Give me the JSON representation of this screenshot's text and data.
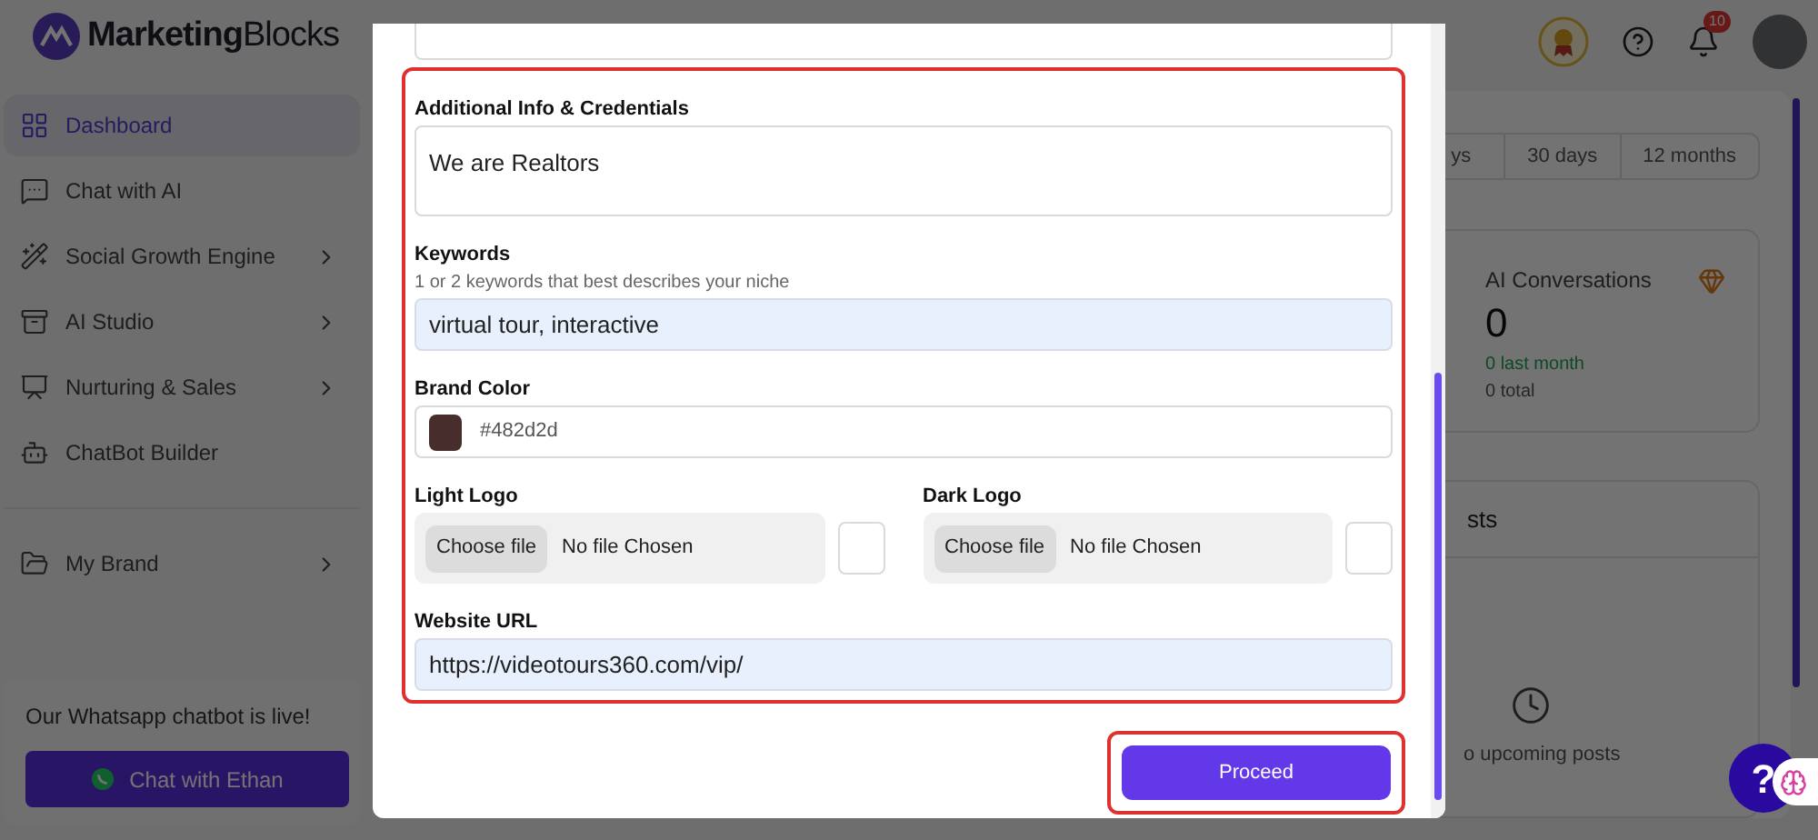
{
  "header": {
    "brand": "**Marketing**Blocks",
    "notification_count": "10"
  },
  "sidebar": {
    "items": [
      {
        "label": "Dashboard",
        "selected": true,
        "has_submenu": false
      },
      {
        "label": "Chat with AI",
        "selected": false,
        "has_submenu": false
      },
      {
        "label": "Social Growth Engine",
        "selected": false,
        "has_submenu": true
      },
      {
        "label": "AI Studio",
        "selected": false,
        "has_submenu": true
      },
      {
        "label": "Nurturing & Sales",
        "selected": false,
        "has_submenu": true
      },
      {
        "label": "ChatBot Builder",
        "selected": false,
        "has_submenu": false
      },
      {
        "label": "My Brand",
        "selected": false,
        "has_submenu": true
      }
    ],
    "promo": {
      "text": "Our Whatsapp chatbot is live!",
      "button": "Chat with Ethan"
    }
  },
  "dashboard": {
    "range_tabs": [
      {
        "label": "ys",
        "selected": false
      },
      {
        "label": "30 days",
        "selected": false
      },
      {
        "label": "12 months",
        "selected": false
      }
    ],
    "stat_card": {
      "title": "AI Conversations",
      "value": "0",
      "change": "0 last month",
      "total": "0 total"
    },
    "posts_card": {
      "title": "sts",
      "empty_text": "o upcoming posts"
    },
    "help_button": "?"
  },
  "modal": {
    "highlighted": true,
    "fields": [
      {
        "kind": "textarea"
      },
      {
        "kind": "textarea",
        "label": "Additional Info & Credentials",
        "value": "We are Realtors"
      },
      {
        "kind": "input",
        "label": "Keywords",
        "hint": "1 or 2 keywords that best describes your niche",
        "value": "virtual tour, interactive",
        "autofilled": true
      },
      {
        "kind": "color",
        "label": "Brand Color",
        "value": "#482d2d",
        "color": "#482d2d"
      },
      {
        "kind": "files",
        "files": [
          {
            "label": "Light Logo",
            "button": "Choose file",
            "status": "No file Chosen"
          },
          {
            "label": "Dark Logo",
            "button": "Choose file",
            "status": "No file Chosen"
          }
        ]
      },
      {
        "kind": "input",
        "label": "Website URL",
        "value": "https://videotours360.com/vip/",
        "autofilled": true
      }
    ],
    "proceed": {
      "label": "Proceed",
      "highlighted": true
    }
  }
}
